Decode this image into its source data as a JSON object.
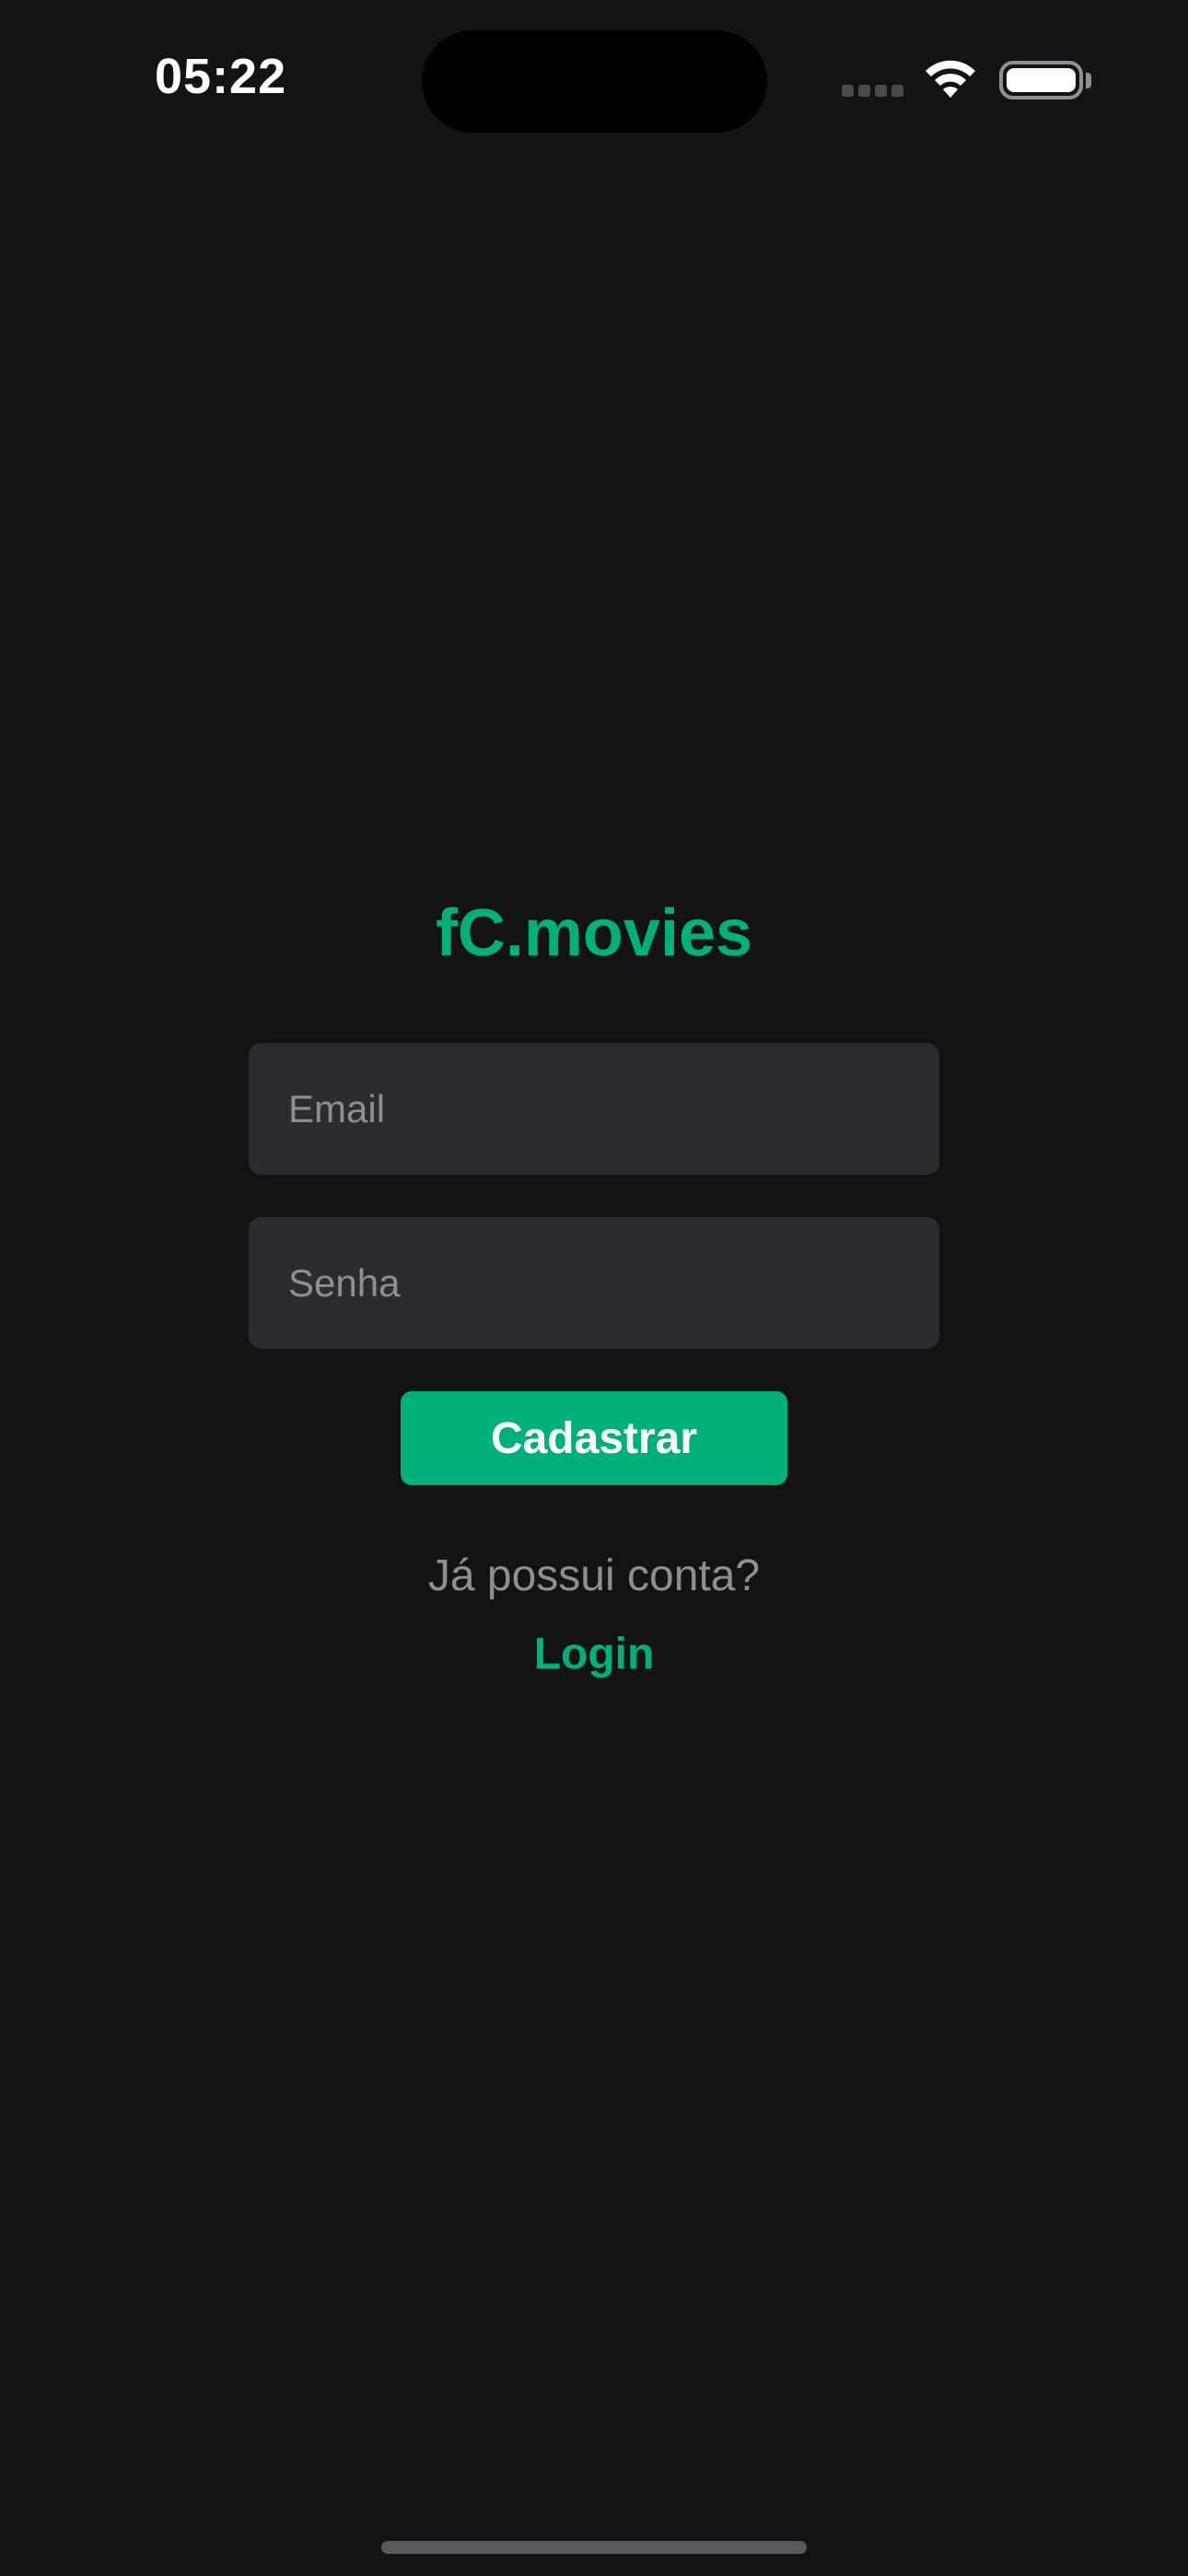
{
  "status_bar": {
    "time": "05:22",
    "icons": [
      "cellular-signal-icon",
      "wifi-icon",
      "battery-icon"
    ]
  },
  "app": {
    "title": "fC.movies"
  },
  "form": {
    "email_placeholder": "Email",
    "email_value": "",
    "password_placeholder": "Senha",
    "password_value": "",
    "submit_label": "Cadastrar"
  },
  "footer": {
    "prompt": "Já possui conta?",
    "login_label": "Login"
  },
  "colors": {
    "background": "#131315",
    "accent": "#00b07b",
    "field_background": "#2c2c30",
    "muted_text": "#8e8e93"
  }
}
